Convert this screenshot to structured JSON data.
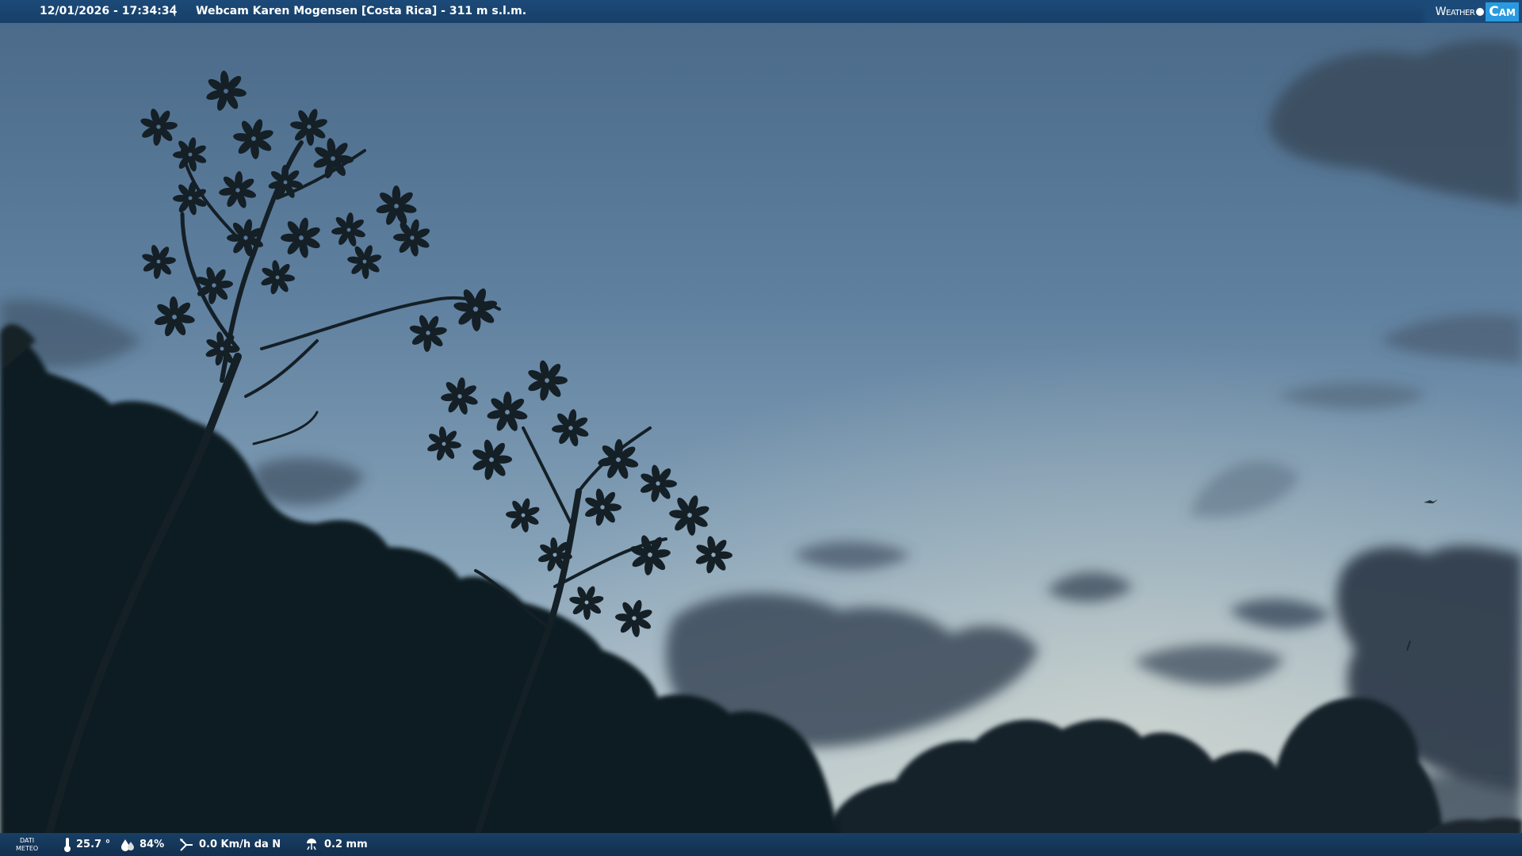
{
  "overlay": {
    "timestamp": "12/01/2026 - 17:34:34",
    "separator": "|",
    "title": "Webcam Karen Mogensen [Costa Rica]  - 311 m s.l.m.",
    "logo_weather": "Weather",
    "logo_cam": "Cam"
  },
  "weather": {
    "label_line1": "DATI",
    "label_line2": "METEO",
    "temperature": "25.7 °",
    "humidity": "84%",
    "wind": "0.0 Km/h da N",
    "rain": "0.2 mm"
  },
  "colors": {
    "bar": "#1c4a78",
    "sky_top": "#4f6f90",
    "sky_horizon": "#b6c8d4",
    "foliage": "#0f1a20"
  },
  "icons": {
    "temperature": "thermometer-icon",
    "humidity": "humidity-drops-icon",
    "wind": "wind-vane-icon",
    "rain": "rain-gauge-icon"
  }
}
